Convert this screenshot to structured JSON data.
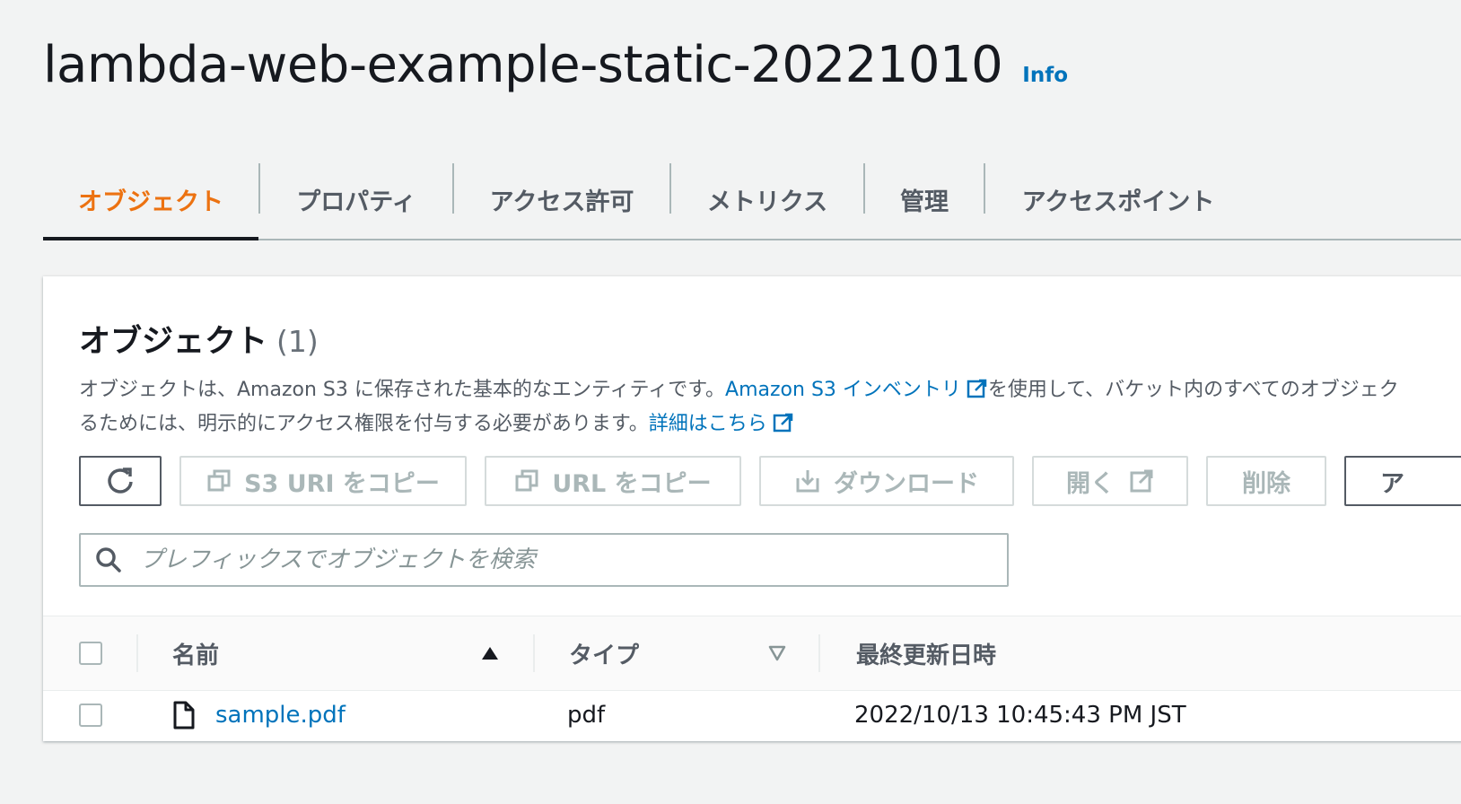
{
  "header": {
    "title": "lambda-web-example-static-20221010",
    "info_label": "Info"
  },
  "tabs": [
    {
      "label": "オブジェクト",
      "active": true
    },
    {
      "label": "プロパティ",
      "active": false
    },
    {
      "label": "アクセス許可",
      "active": false
    },
    {
      "label": "メトリクス",
      "active": false
    },
    {
      "label": "管理",
      "active": false
    },
    {
      "label": "アクセスポイント",
      "active": false
    }
  ],
  "objects_panel": {
    "title": "オブジェクト",
    "count": "(1)",
    "description": {
      "text_1": "オブジェクトは、Amazon S3 に保存された基本的なエンティティです。",
      "link_inventory": "Amazon S3 インベントリ",
      "text_2": "を使用して、バケット内のすべてのオブジェク",
      "text_3": "るためには、明示的にアクセス権限を付与する必要があります。",
      "link_details": "詳細はこちら"
    },
    "toolbar": {
      "copy_s3_uri": "S3 URI をコピー",
      "copy_url": "URL をコピー",
      "download": "ダウンロード",
      "open": "開く",
      "delete": "削除",
      "actions": "ア"
    },
    "search": {
      "placeholder": "プレフィックスでオブジェクトを検索"
    },
    "table": {
      "columns": [
        "名前",
        "タイプ",
        "最終更新日時"
      ],
      "rows": [
        {
          "name": "sample.pdf",
          "type": "pdf",
          "last_modified": "2022/10/13 10:45:43 PM JST"
        }
      ]
    }
  },
  "colors": {
    "accent": "#ec7211",
    "link": "#0073bb",
    "text": "#16191f",
    "muted": "#545b64",
    "disabled": "#aab7b8"
  },
  "icons": [
    "refresh-icon",
    "copy-icon",
    "download-icon",
    "external-link-icon",
    "search-icon",
    "sort-ascending-icon",
    "sort-descending-icon",
    "file-icon"
  ]
}
